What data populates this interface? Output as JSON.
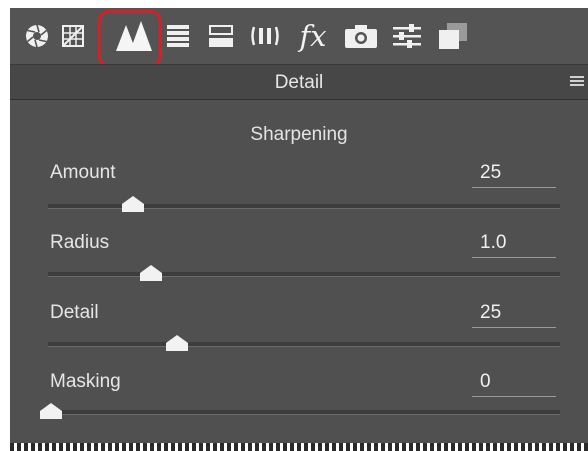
{
  "toolbar": {
    "icons": [
      {
        "name": "aperture-icon"
      },
      {
        "name": "grid-icon"
      },
      {
        "name": "detail-triangles-icon",
        "selected": true
      },
      {
        "name": "hsl-bars-icon"
      },
      {
        "name": "split-toning-icon"
      },
      {
        "name": "lens-corrections-icon"
      },
      {
        "name": "fx-effects-icon",
        "text": "fx"
      },
      {
        "name": "camera-icon"
      },
      {
        "name": "presets-sliders-icon"
      },
      {
        "name": "snapshots-icon"
      }
    ],
    "highlight_color": "#d4202b"
  },
  "panel": {
    "title": "Detail",
    "section": "Sharpening"
  },
  "sliders": [
    {
      "label": "Amount",
      "value": "25",
      "position": 0.17
    },
    {
      "label": "Radius",
      "value": "1.0",
      "position": 0.2
    },
    {
      "label": "Detail",
      "value": "25",
      "position": 0.25
    },
    {
      "label": "Masking",
      "value": "0",
      "position": 0.0
    }
  ],
  "colors": {
    "toolbar_bg": "#545454",
    "panel_bg": "#505050",
    "text": "#e6e6e6"
  }
}
